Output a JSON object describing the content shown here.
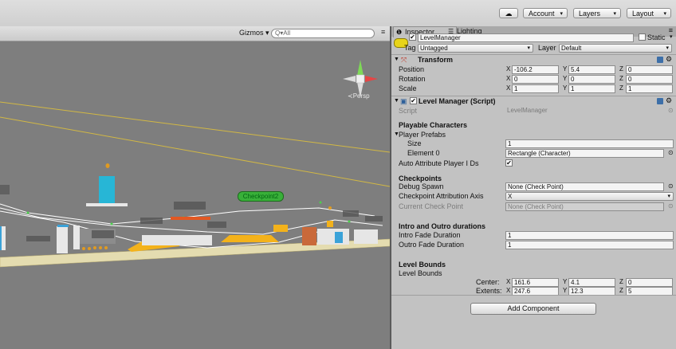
{
  "toolbar": {
    "cloud_icon": "☁",
    "account_label": "Account",
    "layers_label": "Layers",
    "layout_label": "Layout",
    "dropdown_arrow": "▾"
  },
  "scene": {
    "gizmos_label": "Gizmos ▾",
    "search_placeholder": "Q▾All",
    "menu_icon": "≡",
    "persp_label": "≺Persp",
    "checkpoint_label": "Checkpoint2"
  },
  "inspector": {
    "tabs": [
      {
        "icon": "❶",
        "label": "Inspector"
      },
      {
        "icon": "☰",
        "label": "Lighting"
      }
    ],
    "menu_icon": "≡",
    "object": {
      "name": "LevelManager",
      "active_checked": "✔",
      "static_label": "Static",
      "tag_label": "Tag",
      "tag_value": "Untagged",
      "layer_label": "Layer",
      "layer_value": "Default"
    },
    "transform": {
      "title": "Transform",
      "position_label": "Position",
      "rotation_label": "Rotation",
      "scale_label": "Scale",
      "position": {
        "x": "-106.2",
        "y": "5.4",
        "z": "0"
      },
      "rotation": {
        "x": "0",
        "y": "0",
        "z": "0"
      },
      "scale": {
        "x": "1",
        "y": "1",
        "z": "1"
      }
    },
    "axis": {
      "x": "X",
      "y": "Y",
      "z": "Z"
    },
    "level_manager": {
      "title": "Level Manager (Script)",
      "script_label": "Script",
      "script_value": "LevelManager",
      "playable_header": "Playable Characters",
      "player_prefabs_label": "Player Prefabs",
      "size_label": "Size",
      "size_value": "1",
      "element0_label": "Element 0",
      "element0_value": "Rectangle (Character)",
      "auto_attr_label": "Auto Attribute Player I Ds",
      "auto_attr_checked": "✔",
      "checkpoints_header": "Checkpoints",
      "debug_spawn_label": "Debug Spawn",
      "debug_spawn_value": "None (Check Point)",
      "cp_axis_label": "Checkpoint Attribution Axis",
      "cp_axis_value": "X",
      "current_cp_label": "Current Check Point",
      "current_cp_value": "None (Check Point)",
      "intro_header": "Intro and Outro durations",
      "intro_label": "Intro Fade Duration",
      "intro_value": "1",
      "outro_label": "Outro Fade Duration",
      "outro_value": "1",
      "bounds_header": "Level Bounds",
      "bounds_label": "Level Bounds",
      "center_label": "Center:",
      "extents_label": "Extents:",
      "center": {
        "x": "161.6",
        "y": "4.1",
        "z": "0"
      },
      "extents": {
        "x": "247.6",
        "y": "12.3",
        "z": "5"
      }
    },
    "add_component_label": "Add Component"
  },
  "colors": {
    "scene_bg": "#7e7e7e",
    "ground": "#e4dcb0",
    "bounds_line": "#d2b844",
    "checkpoint_green": "#39b039",
    "inspector_bg": "#c2c2c2"
  }
}
